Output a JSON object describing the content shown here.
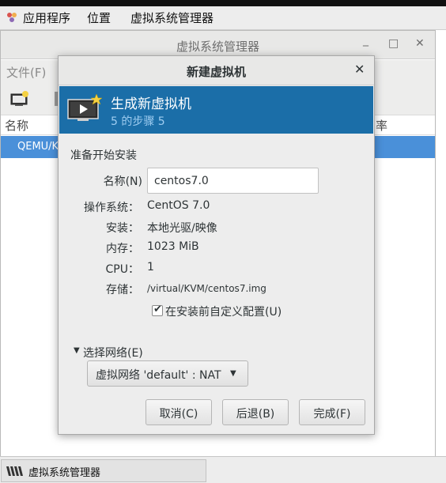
{
  "top_panel": {
    "applications": "应用程序",
    "places": "位置",
    "app_name": "虚拟系统管理器"
  },
  "main_window": {
    "title": "虚拟系统管理器",
    "menu_file": "文件(F)",
    "col_name": "名称",
    "col_cpu_partial": "率",
    "row_connection": "QEMU/KV"
  },
  "dialog": {
    "title": "新建虚拟机",
    "banner_title": "生成新虚拟机",
    "banner_step": "5 的步骤 5",
    "section": "准备开始安装",
    "name_label": "名称(N)",
    "name_value": "centos7.0",
    "details": [
      {
        "label": "操作系统：",
        "value": "CentOS 7.0"
      },
      {
        "label": "安装：",
        "value": "本地光驱/映像"
      },
      {
        "label": "内存：",
        "value": "1023 MiB"
      },
      {
        "label": "CPU：",
        "value": "1"
      },
      {
        "label": "存储：",
        "value": "/virtual/KVM/centos7.img"
      }
    ],
    "customize_label": "在安装前自定义配置(U)",
    "customize_checked": true,
    "network_expander": "选择网络(E)",
    "network_selected": "虚拟网络  'default' : NAT",
    "buttons": {
      "cancel": "取消(C)",
      "back": "后退(B)",
      "finish": "完成(F)"
    }
  },
  "taskbar": {
    "item": "虚拟系统管理器"
  },
  "colors": {
    "banner_bg": "#1b6ea8",
    "selection": "#4a90d9"
  }
}
